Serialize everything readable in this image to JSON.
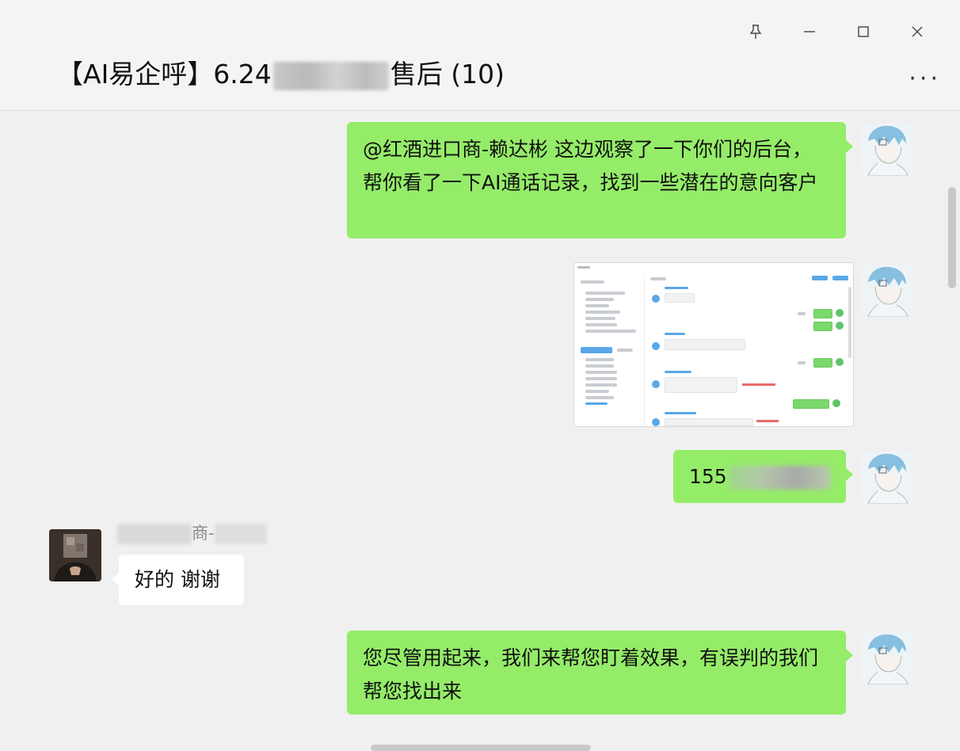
{
  "window": {
    "title_prefix": "【AI易企呼】6.24",
    "title_suffix": "售后 (10)",
    "controls": [
      "pin",
      "minimize",
      "maximize",
      "close"
    ],
    "more_label": "···"
  },
  "messages": [
    {
      "direction": "outgoing",
      "type": "text",
      "text": "@红酒进口商-赖达彬 这边观察了一下你们的后台，帮你看了一下AI通话记录，找到一些潜在的意向客户"
    },
    {
      "direction": "outgoing",
      "type": "image",
      "description_icon": "screenshot-thumbnail"
    },
    {
      "direction": "outgoing",
      "type": "text",
      "text_visible": "155"
    },
    {
      "direction": "incoming",
      "sender_visible": "商-",
      "type": "text",
      "text": "好的 谢谢"
    },
    {
      "direction": "outgoing",
      "type": "text",
      "text": "您尽管用起来，我们来帮您盯着效果，有误判的我们帮您找出来"
    }
  ],
  "colors": {
    "outgoing_bubble": "#95ec69",
    "incoming_bubble": "#ffffff",
    "background": "#f0f0f0",
    "titlebar": "#f4f4f4"
  }
}
